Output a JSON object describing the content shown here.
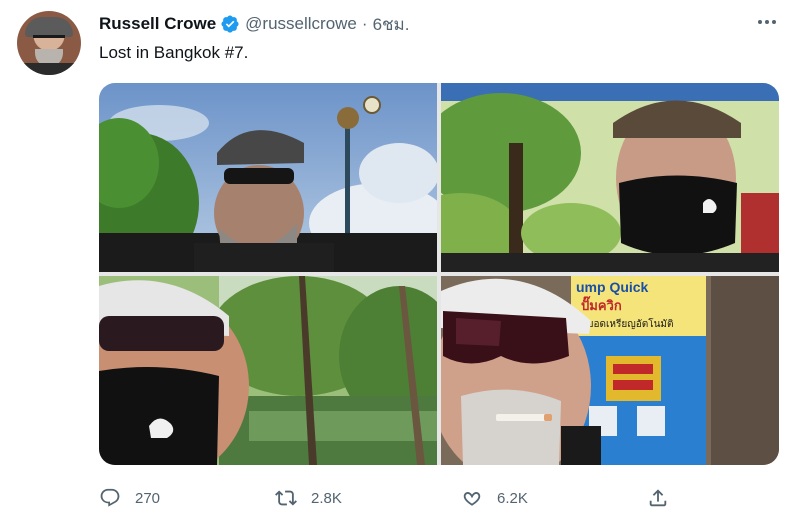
{
  "tweet": {
    "author": {
      "name": "Russell Crowe",
      "handle": "@russellcrowe",
      "separator": "·",
      "time": "6ชม."
    },
    "text": "Lost in Bangkok #7.",
    "actions": {
      "reply_count": "270",
      "retweet_count": "2.8K",
      "like_count": "6.2K"
    },
    "photos": {
      "p4_sign_text": "ump Quick",
      "p4_thai_line1": "ปั๊มควิก",
      "p4_thai_line2": "หยอดเหรียญอัตโนมัติ"
    }
  },
  "colors": {
    "verified": "#1d9bf0",
    "text_secondary": "#536471",
    "text_primary": "#0f1419"
  },
  "icons": [
    "verified-badge-icon",
    "more-options-icon",
    "reply-icon",
    "retweet-icon",
    "like-icon",
    "share-icon"
  ]
}
